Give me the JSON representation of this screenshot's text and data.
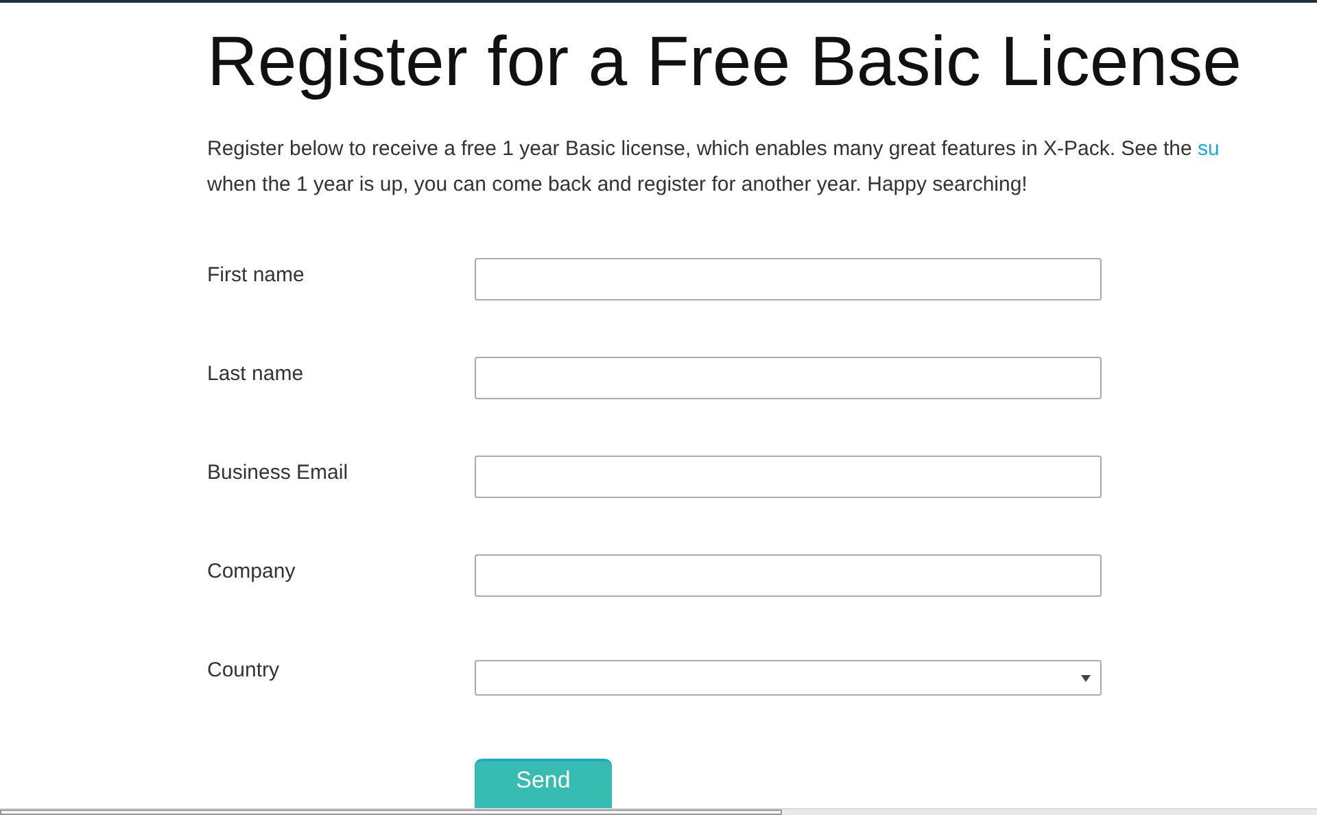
{
  "title": "Register for a Free Basic License",
  "intro": {
    "text": "Register below to receive a free 1 year Basic license, which enables many great features in X-Pack. See the ",
    "link": "su",
    "continuation": "when the 1 year is up, you can come back and register for another year. Happy searching!"
  },
  "fields": [
    {
      "label": "First name",
      "kind": "text"
    },
    {
      "label": "Last name",
      "kind": "text"
    },
    {
      "label": "Business Email",
      "kind": "text"
    },
    {
      "label": "Company",
      "kind": "text"
    },
    {
      "label": "Country",
      "kind": "select"
    }
  ],
  "submit": "Send"
}
